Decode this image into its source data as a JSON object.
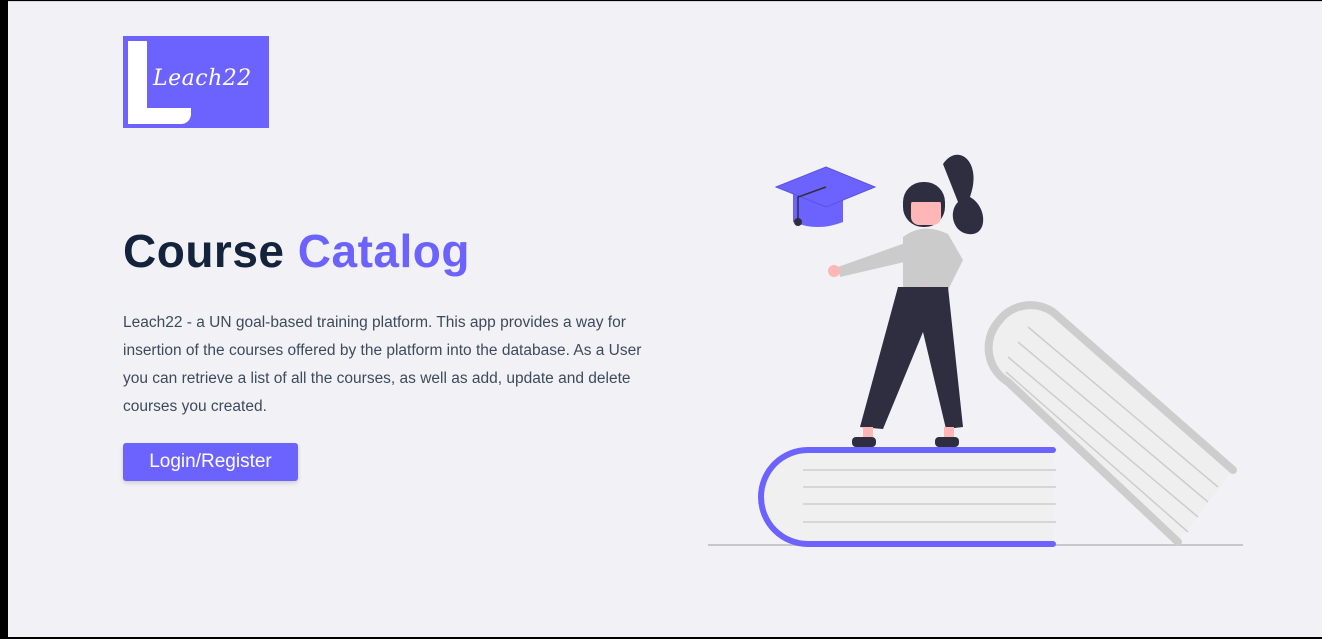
{
  "logo": {
    "text": "Leach22"
  },
  "hero": {
    "title_part1": "Course",
    "title_part2": "Catalog",
    "description": "Leach22 - a UN goal-based training platform. This app provides a way for insertion of the courses offered by the platform into the database. As a User you can retrieve a list of all the courses, as well as add, update and delete courses you created.",
    "button_label": "Login/Register"
  },
  "colors": {
    "accent": "#6c63ff",
    "title": "#14233c",
    "background": "#f2f2f6"
  }
}
